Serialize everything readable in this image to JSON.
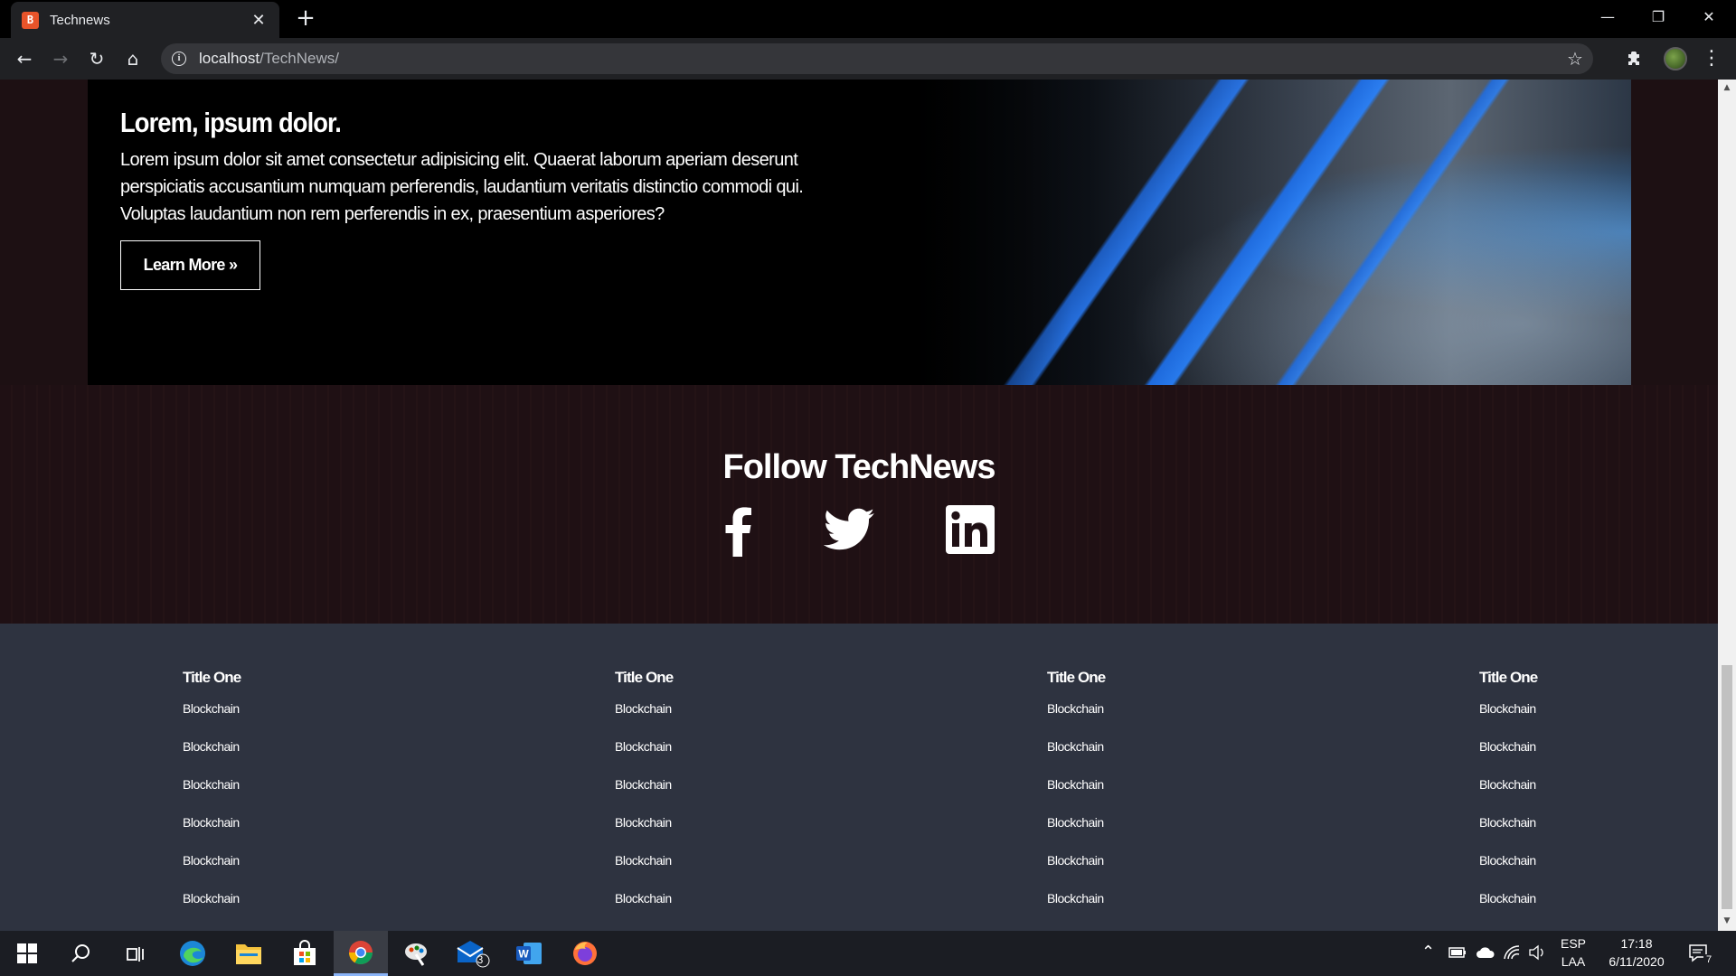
{
  "browser": {
    "tab_title": "Technews",
    "tab_favicon": "🄱",
    "new_tab": "+",
    "url_host": "localhost",
    "url_path": "/TechNews/"
  },
  "hero": {
    "title": "Lorem, ipsum dolor.",
    "text": "Lorem ipsum dolor sit amet consectetur adipisicing elit. Quaerat laborum aperiam deserunt perspiciatis accusantium numquam perferendis, laudantium veritatis distinctio commodi qui. Voluptas laudantium non rem perferendis in ex, praesentium asperiores?",
    "button_label": "Learn More »"
  },
  "follow": {
    "title": "Follow TechNews",
    "icons": [
      "facebook-icon",
      "twitter-icon",
      "linkedin-icon"
    ]
  },
  "footer": {
    "columns": [
      {
        "title": "Title One",
        "links": [
          "Blockchain",
          "Blockchain",
          "Blockchain",
          "Blockchain",
          "Blockchain",
          "Blockchain"
        ]
      },
      {
        "title": "Title One",
        "links": [
          "Blockchain",
          "Blockchain",
          "Blockchain",
          "Blockchain",
          "Blockchain",
          "Blockchain"
        ]
      },
      {
        "title": "Title One",
        "links": [
          "Blockchain",
          "Blockchain",
          "Blockchain",
          "Blockchain",
          "Blockchain",
          "Blockchain"
        ]
      },
      {
        "title": "Title One",
        "links": [
          "Blockchain",
          "Blockchain",
          "Blockchain",
          "Blockchain",
          "Blockchain",
          "Blockchain"
        ]
      }
    ]
  },
  "taskbar": {
    "language_top": "ESP",
    "language_bottom": "LAA",
    "time": "17:18",
    "date": "6/11/2020",
    "mail_badge": "3",
    "notification_count": "7"
  },
  "colors": {
    "footer_bg": "#2e3340",
    "follow_bg": "#1f1014",
    "accent_blue": "#2a7de1"
  }
}
